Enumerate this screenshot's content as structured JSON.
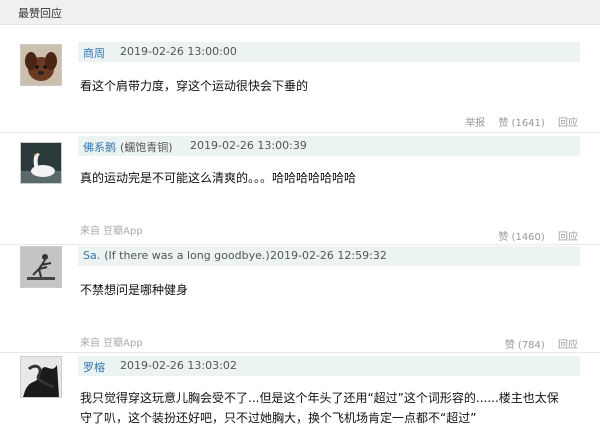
{
  "section": {
    "title": "最赞回应"
  },
  "comments": [
    {
      "name": "商周",
      "signature": "",
      "time": "2019-02-26 13:00:00",
      "text": "看这个肩带力度，穿这个运动很快会下垂的",
      "source": "",
      "report_label": "举报",
      "like_label": "赞 (1641)",
      "reply_label": "回应",
      "avatar": "puppy-avatar"
    },
    {
      "name": "佛系鹅",
      "signature": "(蠕饱青铜)",
      "time": "2019-02-26 13:00:39",
      "text": "真的运动完是不可能这么清爽的。。。哈哈哈哈哈哈哈",
      "source": "来自 豆瓣App",
      "report_label": "",
      "like_label": "赞 (1460)",
      "reply_label": "回应",
      "avatar": "goose-avatar"
    },
    {
      "name": "Sa.",
      "signature": "(If there was a long goodbye.)",
      "time": "2019-02-26 12:59:32",
      "text": "不禁想问是哪种健身",
      "source": "来自 豆瓣App",
      "report_label": "",
      "like_label": "赞 (784)",
      "reply_label": "回应",
      "avatar": "figure-avatar"
    },
    {
      "name": "罗榕",
      "signature": "",
      "time": "2019-02-26 13:03:02",
      "text_line1": "我只觉得穿这玩意儿胸会受不了...但是这个年头了还用“超过”这个词形容的......楼主也太保",
      "text_line2": "守了叭，这个装扮还好吧，只不过她胸大，换个飞机场肯定一点都不“超过”",
      "avatar": "ink-avatar"
    }
  ]
}
